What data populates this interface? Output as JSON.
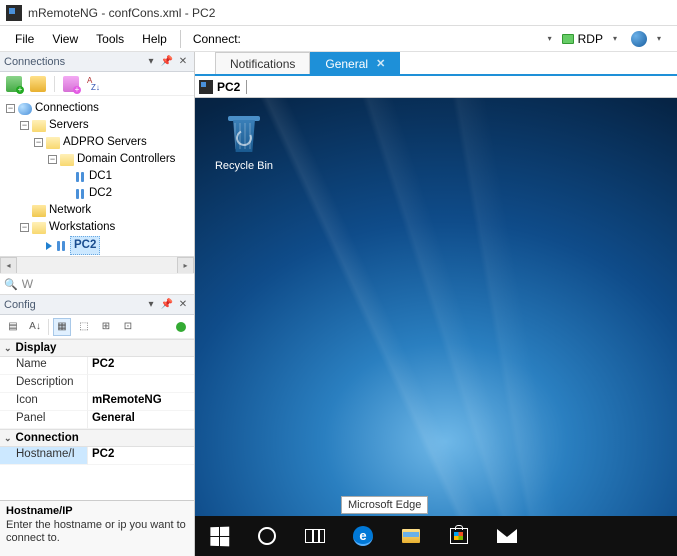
{
  "title": "mRemoteNG - confCons.xml - PC2",
  "menu": {
    "file": "File",
    "view": "View",
    "tools": "Tools",
    "help": "Help",
    "connect": "Connect:",
    "protocol": "RDP"
  },
  "panels": {
    "connections": "Connections",
    "config": "Config"
  },
  "tree": {
    "root": "Connections",
    "servers": "Servers",
    "adpro": "ADPRO Servers",
    "dc": "Domain Controllers",
    "dc1": "DC1",
    "dc2": "DC2",
    "network": "Network",
    "workstations": "Workstations",
    "pc2": "PC2"
  },
  "search": {
    "value": "W"
  },
  "config": {
    "cat_display": "Display",
    "cat_connection": "Connection",
    "name_lbl": "Name",
    "name_val": "PC2",
    "desc_lbl": "Description",
    "desc_val": "",
    "icon_lbl": "Icon",
    "icon_val": "mRemoteNG",
    "panel_lbl": "Panel",
    "panel_val": "General",
    "host_lbl": "Hostname/I",
    "host_val": "PC2"
  },
  "help": {
    "title": "Hostname/IP",
    "desc": "Enter the hostname or ip you want to connect to."
  },
  "tabs": {
    "notifications": "Notifications",
    "general": "General"
  },
  "address": "PC2",
  "desktop": {
    "recycle": "Recycle Bin",
    "tooltip": "Microsoft Edge"
  }
}
